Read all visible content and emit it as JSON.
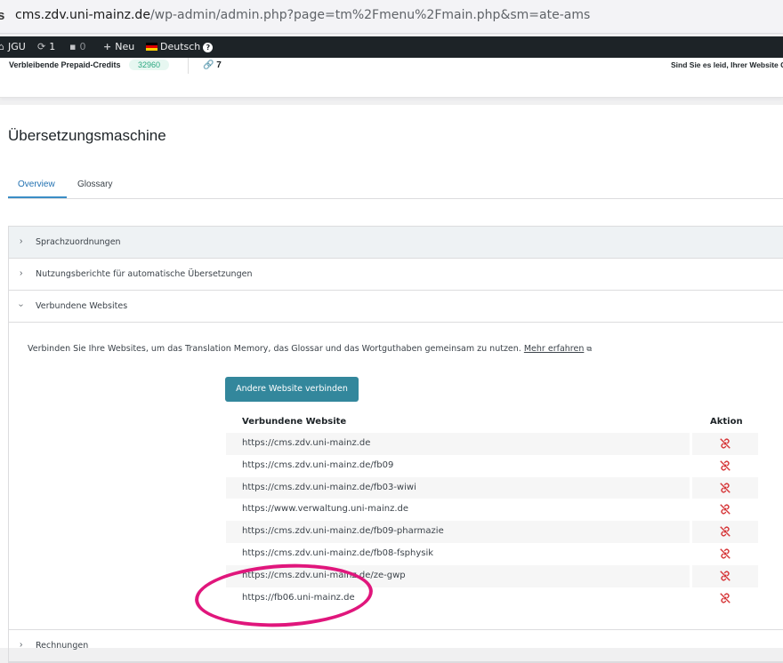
{
  "browser": {
    "lock_glyph": "s",
    "url_host": "cms.zdv.uni-mainz.de",
    "url_path": "/wp-admin/admin.php?page=tm%2Fmenu%2Fmain.php&sm=ate-ams"
  },
  "adminbar": {
    "site": "JGU",
    "updates_count": "1",
    "comments_count": "0",
    "new_label": "Neu",
    "language": "Deutsch"
  },
  "credits": {
    "label": "Verbleibende Prepaid-Credits",
    "value": "32960",
    "links_count": "7",
    "promo": "Sind Sie es leid, Ihrer Website C"
  },
  "page": {
    "title": "Übersetzungsmaschine",
    "tabs": [
      {
        "label": "Overview",
        "active": true
      },
      {
        "label": "Glossary",
        "active": false
      }
    ]
  },
  "accordion": {
    "sections": [
      {
        "label": "Sprachzuordnungen",
        "expanded": false
      },
      {
        "label": "Nutzungsberichte für automatische Übersetzungen",
        "expanded": false
      },
      {
        "label": "Verbundene Websites",
        "expanded": true
      },
      {
        "label": "Rechnungen",
        "expanded": false
      }
    ],
    "connected": {
      "intro": "Verbinden Sie Ihre Websites, um das Translation Memory, das Glossar und das Wortguthaben gemeinsam zu nutzen.",
      "learn_more": "Mehr erfahren",
      "connect_button": "Andere Website verbinden",
      "col_site": "Verbundene Website",
      "col_action": "Aktion",
      "sites": [
        "https://cms.zdv.uni-mainz.de",
        "https://cms.zdv.uni-mainz.de/fb09",
        "https://cms.zdv.uni-mainz.de/fb03-wiwi",
        "https://www.verwaltung.uni-mainz.de",
        "https://cms.zdv.uni-mainz.de/fb09-pharmazie",
        "https://cms.zdv.uni-mainz.de/fb08-fsphysik",
        "https://cms.zdv.uni-mainz.de/ze-gwp",
        "https://fb06.uni-mainz.de"
      ]
    }
  },
  "colors": {
    "accent": "#2271b1",
    "button": "#33879c",
    "unlink_icon": "#d63638",
    "highlight_ring": "#e0167c",
    "credits_badge": "#2aa77f"
  }
}
